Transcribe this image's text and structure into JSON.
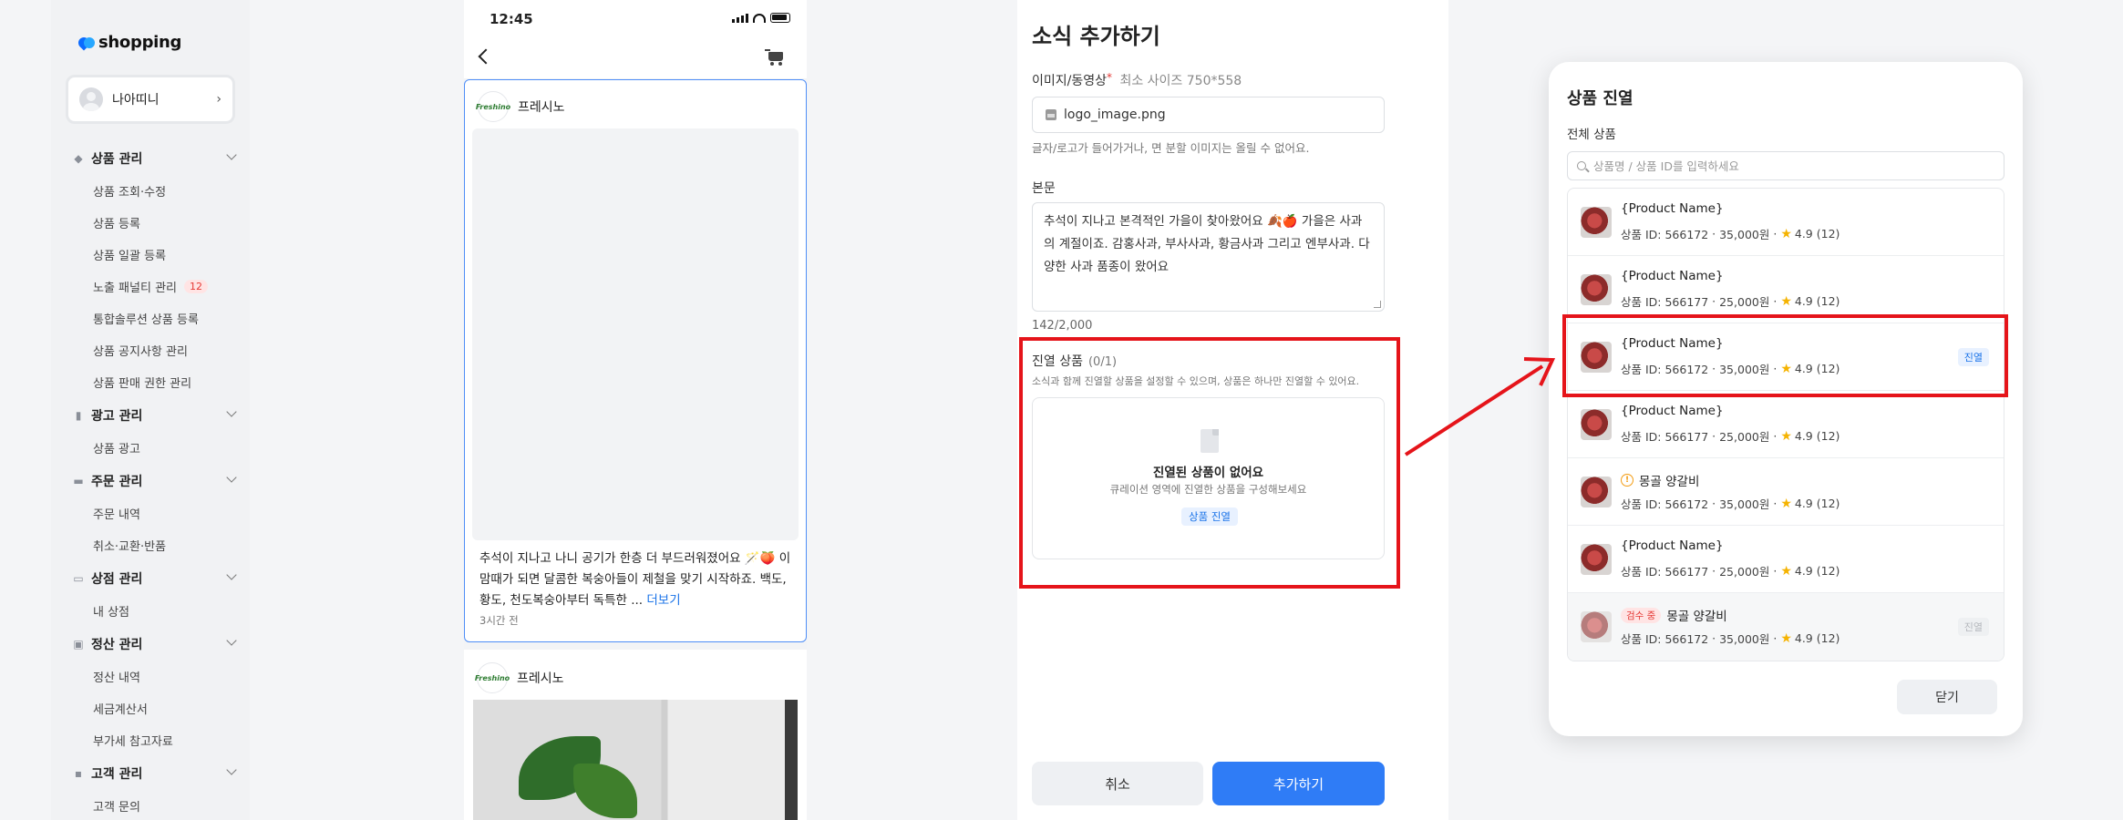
{
  "sidebar": {
    "logo": "shopping",
    "user": {
      "name": "나아띠니"
    },
    "sections": [
      {
        "label": "상품 관리",
        "icon": "tag-icon",
        "items": [
          {
            "label": "상품 조회·수정"
          },
          {
            "label": "상품 등록"
          },
          {
            "label": "상품 일괄 등록"
          },
          {
            "label": "노출 패널티 관리",
            "badge": "12"
          },
          {
            "label": "통합솔루션 상품 등록"
          },
          {
            "label": "상품 공지사항 관리"
          },
          {
            "label": "상품 판매 권한 관리"
          }
        ]
      },
      {
        "label": "광고 관리",
        "icon": "bar-chart-icon",
        "items": [
          {
            "label": "상품 광고"
          }
        ]
      },
      {
        "label": "주문 관리",
        "icon": "cart-icon",
        "items": [
          {
            "label": "주문 내역"
          },
          {
            "label": "취소·교환·반품"
          }
        ]
      },
      {
        "label": "상점 관리",
        "icon": "store-icon",
        "items": [
          {
            "label": "내 상점"
          }
        ]
      },
      {
        "label": "정산 관리",
        "icon": "calculator-icon",
        "items": [
          {
            "label": "정산 내역"
          },
          {
            "label": "세금계산서"
          },
          {
            "label": "부가세 참고자료"
          }
        ]
      },
      {
        "label": "고객 관리",
        "icon": "chat-icon",
        "items": [
          {
            "label": "고객 문의"
          }
        ]
      }
    ]
  },
  "phone": {
    "time": "12:45",
    "posts": [
      {
        "brand_logo": "Freshino",
        "brand": "프레시노",
        "text_prefix": "추석이 지나고 나니 공기가 한층 더 부드러워졌어요 🪄🍑 이맘때가 되면 달콤한 복숭아들이 제철을 맞기 시작하죠. 백도, 황도, 천도복숭아부터 독특한 ...",
        "more": "더보기",
        "time_ago": "3시간 전"
      },
      {
        "brand_logo": "Freshino",
        "brand": "프레시노"
      }
    ]
  },
  "form": {
    "title": "소식 추가하기",
    "media_label": "이미지/동영상",
    "media_required": "*",
    "media_hint": "최소 사이즈 750*558",
    "file_name": "logo_image.png",
    "media_note": "글자/로고가 들어가거나, 면 분할 이미지는 올릴 수 없어요.",
    "body_label": "본문",
    "body_text": "추석이 지나고 본격적인 가을이 찾아왔어요 🍂🍎 가을은 사과의 계절이죠. 감홍사과, 부사사과, 황금사과 그리고 엔부사과. 다양한 사과 품종이 왔어요",
    "counter": "142/2,000",
    "display_label": "진열 상품",
    "display_count": "(0/1)",
    "display_hint": "소식과 함께 진열할 상품을 설정할 수 있으며, 상품은 하나만 진열할 수 있어요.",
    "empty_title": "진열된 상품이 없어요",
    "empty_sub": "큐레이션 영역에 진열한 상품을 구성해보세요",
    "empty_button": "상품 진열",
    "cancel": "취소",
    "submit": "추가하기"
  },
  "modal": {
    "title": "상품 진열",
    "subtitle": "전체 상품",
    "search_placeholder": "상품명 / 상품 ID를 입력하세요",
    "products": [
      {
        "name": "{Product Name}",
        "id": "상품 ID: 566172",
        "price": "35,000원",
        "rating": "4.9",
        "reviews": "(12)",
        "badge": ""
      },
      {
        "name": "{Product Name}",
        "id": "상품 ID: 566177",
        "price": "25,000원",
        "rating": "4.9",
        "reviews": "(12)",
        "badge": ""
      },
      {
        "name": "{Product Name}",
        "id": "상품 ID: 566172",
        "price": "35,000원",
        "rating": "4.9",
        "reviews": "(12)",
        "badge": "진열"
      },
      {
        "name": "{Product Name}",
        "id": "상품 ID: 566177",
        "price": "25,000원",
        "rating": "4.9",
        "reviews": "(12)",
        "badge": ""
      },
      {
        "name": "몽골 양갈비",
        "id": "상품 ID: 566172",
        "price": "35,000원",
        "rating": "4.9",
        "reviews": "(12)",
        "badge": "",
        "icon": "warning-icon"
      },
      {
        "name": "{Product Name}",
        "id": "상품 ID: 566177",
        "price": "25,000원",
        "rating": "4.9",
        "reviews": "(12)",
        "badge": ""
      },
      {
        "name": "몽골 양갈비",
        "tag": "검수 중",
        "id": "상품 ID: 566172",
        "price": "35,000원",
        "rating": "4.9",
        "reviews": "(12)",
        "badge": "진열",
        "disabled": true
      }
    ],
    "close": "닫기"
  },
  "colors": {
    "accent": "#2f7cf6",
    "highlight": "#e5141a",
    "star": "#f5b301"
  }
}
